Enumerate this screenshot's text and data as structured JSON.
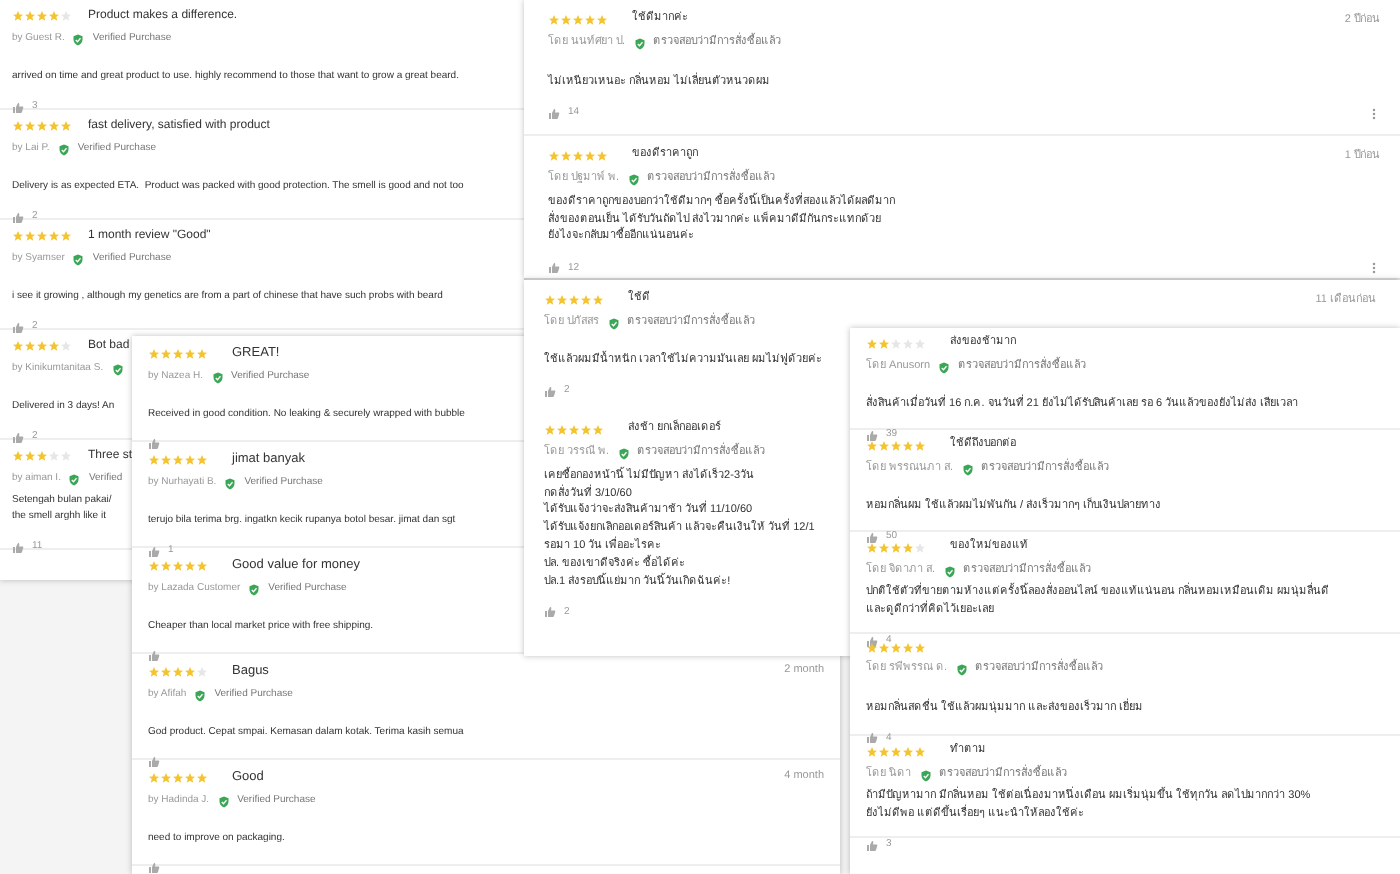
{
  "panels": [
    {
      "reviews": [
        {
          "stars": 4,
          "title": "Product makes a difference.",
          "author": "by Guest R.",
          "badge": "Verified Purchase",
          "body": "arrived on time and great product to use. highly recommend to those that want to grow a great beard.",
          "likes": "3"
        },
        {
          "stars": 5,
          "title": "fast delivery, satisfied with product",
          "author": "by Lai P.",
          "badge": "Verified Purchase",
          "body": "Delivery is as expected ETA.  Product was packed with good protection. The smell is good and not too",
          "likes": "2"
        },
        {
          "stars": 5,
          "title": "1 month review \"Good\"",
          "author": "by Syamser",
          "badge": "Verified Purchase",
          "body": "i see it growing , although my genetics are from a part of chinese that have such probs with beard",
          "likes": "2"
        },
        {
          "stars": 4,
          "title": "Bot bad",
          "author": "by Kinikumtanitaa S.",
          "body": "Delivered in 3 days! An",
          "likes": "2"
        },
        {
          "stars": 3,
          "title": "Three st",
          "author": "by aiman I.",
          "badge": "Verified",
          "body": "Setengah bulan pakai/\nthe smell arghh like it",
          "likes": "11"
        }
      ]
    },
    {
      "reviews": [
        {
          "stars": 5,
          "title": "GREAT!",
          "author": "by Nazea H.",
          "badge": "Verified Purchase",
          "body": "Received in good condition. No leaking & securely wrapped with bubble"
        },
        {
          "stars": 5,
          "title": "jimat banyak",
          "author": "by Nurhayati B.",
          "badge": "Verified Purchase",
          "body": "terujo bila terima brg. ingatkn kecik rupanya botol besar. jimat dan sgt",
          "likes": "1"
        },
        {
          "stars": 5,
          "title": "Good value for money",
          "author": "by Lazada Customer",
          "badge": "Verified Purchase",
          "body": "Cheaper than local market price with free shipping."
        },
        {
          "stars": 4,
          "title": "Bagus",
          "author": "by Afifah",
          "badge": "Verified Purchase",
          "body": "God product. Cepat smpai. Kemasan dalam kotak. Terima kasih semua",
          "time": "2 month"
        },
        {
          "stars": 5,
          "title": "Good",
          "author": "by Hadinda J.",
          "badge": "Verified Purchase",
          "body": "need to improve on packaging.",
          "time": "4 month"
        }
      ]
    },
    {
      "reviews": [
        {
          "stars": 5,
          "title": "ใช้ดีมากค่ะ",
          "author": "โดย นนท์ศยา ป.",
          "badge": "ตรวจสอบว่ามีการสั่งซื้อแล้ว",
          "body": "ไม่เหนียวเหนอะ กลิ่นหอม ไม่เลี่ยนตัวหนวดผม",
          "likes": "14",
          "time": "2 ปีก่อน",
          "menu": true
        },
        {
          "stars": 5,
          "title": "ของดีราคาถูก",
          "author": "โดย ปฐมาพ์ พ.",
          "badge": "ตรวจสอบว่ามีการสั่งซื้อแล้ว",
          "body": "ของดีราคาถูกของบอกว่าใช้ดีมากๆ ซื้อครั้งนี้เป็นครั้งที่สองแล้วได้ผลดีมาก\nสั่งของตอนเย็น ได้รับวันถัดไป ส่งไวมากค่ะ แพ็คมาดีมีกันกระแทกด้วย\nยังไงจะกลับมาซื้ออีกแน่นอนค่ะ",
          "likes": "12",
          "time": "1 ปีก่อน",
          "menu": true
        }
      ]
    },
    {
      "time": "11 เดือนก่อน",
      "reviews": [
        {
          "stars": 5,
          "title": "ใช้ดี",
          "author": "โดย ปภัสสร",
          "badge": "ตรวจสอบว่ามีการสั่งซื้อแล้ว",
          "body": "ใช้แล้วผมมีน้ำหนัก เวลาใช้ไม่ความมันเลย ผมไม่ฟูด้วยค่ะ",
          "likes": "2"
        },
        {
          "stars": 5,
          "title": "ส่งช้า ยกเล็กออเดอร์",
          "author": "โดย วรรณี พ.",
          "badge": "ตรวจสอบว่ามีการสั่งซื้อแล้ว",
          "body": "เคยซื้อกองหน้านี้ ไม่มีปัญหา ส่งได้เร็ว2-3วัน\nกดสั่งวันที่ 3/10/60\nได้รับแจ้งว่าจะส่งสินค้ามาช้า วันที่ 11/10/60\nได้รับแจ้งยกเลิกออเดอร์สินค้า แล้วจะคืนเงินให้ วันที่ 12/1\nรอมา 10 วัน เพื่ออะไรคะ\nปล. ของเขาดีจริงค่ะ ซื้อได้ค่ะ\nปล.1 ส่งรอบนี้แย่มาก วันนี้วันเกิดฉันค่ะ!",
          "likes": "2"
        }
      ]
    },
    {
      "reviews": [
        {
          "stars": 2,
          "title": "ส่งของช้ามาก",
          "author": "โดย Anusorn",
          "badge": "ตรวจสอบว่ามีการสั่งซื้อแล้ว",
          "body": "สั่งสินค้าเมื่อวันที่ 16 ก.ค. จนวันที่ 21 ยังไม่ได้รับสินค้าเลย รอ 6 วันแล้วของยังไม่ส่ง เสียเวลา",
          "likes": "39"
        },
        {
          "stars": 5,
          "title": "ใช้ดีถึงบอกต่อ",
          "author": "โดย พรรณนภา ส.",
          "badge": "ตรวจสอบว่ามีการสั่งซื้อแล้ว",
          "body": "หอมกลิ่นผม ใช้แล้วผมไม่พันกัน / ส่งเร็วมากๆ เก็บเงินปลายทาง",
          "likes": "50"
        },
        {
          "stars": 4,
          "title": "ของใหม่ของแท้",
          "author": "โดย จิดาภา ส.",
          "badge": "ตรวจสอบว่ามีการสั่งซื้อแล้ว",
          "body": "ปกติใช้ตัวที่ขายตามห้างแต่ครั้งนี้ลองสั่งออนไลน์ ของแท้แน่นอน กลิ่นหอมเหมือนเดิม ผมนุ่มลื่นดี\nและดูดีกว่าที่คิดไว้เยอะเลย",
          "likes": "4"
        },
        {
          "stars": 5,
          "author": "โดย รพีพรรณ ด.",
          "badge": "ตรวจสอบว่ามีการสั่งซื้อแล้ว",
          "body": "หอมกลิ่นสดชื่น ใช้แล้วผมนุ่มมาก และส่งของเร็วมาก เยี่ยม",
          "likes": "4"
        },
        {
          "stars": 5,
          "title": "ทำตาม",
          "author": "โดย นิดา",
          "badge": "ตรวจสอบว่ามีการสั่งซื้อแล้ว",
          "body": "ถ้ามีปัญหามาก มีกลิ่นหอม ใช้ต่อเนื่องมาหนึ่งเดือน ผมเริ่มนุ่มขึ้น ใช้ทุกวัน ลดไปมากกว่า 30%\nยังไม่ดีพอ แต่ดีขึ้นเรื่อยๆ แนะนำให้ลองใช้ค่ะ",
          "likes": "3"
        }
      ]
    }
  ]
}
